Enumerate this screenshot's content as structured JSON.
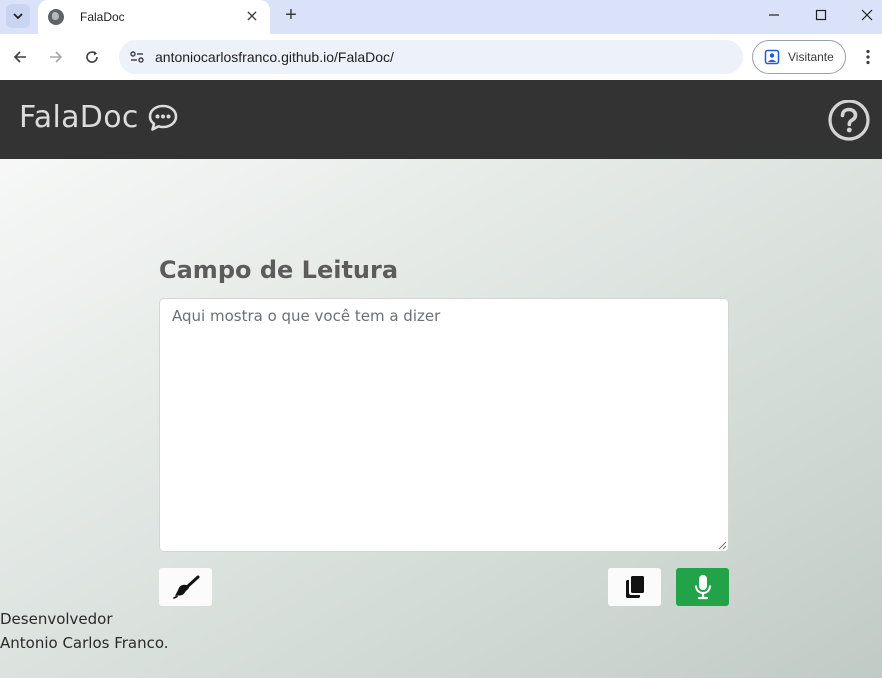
{
  "browser": {
    "tab_title": "FalaDoc",
    "url_host": "antoniocarlosfranco.github.io",
    "url_path": "/FalaDoc/",
    "profile_label": "Visitante",
    "new_tab_glyph": "+",
    "close_glyph": "×"
  },
  "header": {
    "brand": "FalaDoc",
    "brand_icon": "chat-bubble-icon",
    "help_icon": "question-circle-icon"
  },
  "main": {
    "section_title": "Campo de Leitura",
    "textarea_placeholder": "Aqui mostra o que você tem a dizer",
    "textarea_value": "",
    "buttons": [
      {
        "name": "clear-button",
        "icon": "broom-icon"
      },
      {
        "name": "copy-button",
        "icon": "copy-icon"
      },
      {
        "name": "mic-button",
        "icon": "microphone-icon"
      }
    ]
  },
  "footer": {
    "line1": "Desenvolvedor",
    "line2": "Antonio Carlos Franco."
  },
  "colors": {
    "header_bg": "#333333",
    "mic_button": "#22a349",
    "tabbar_bg": "#dae2f9"
  }
}
